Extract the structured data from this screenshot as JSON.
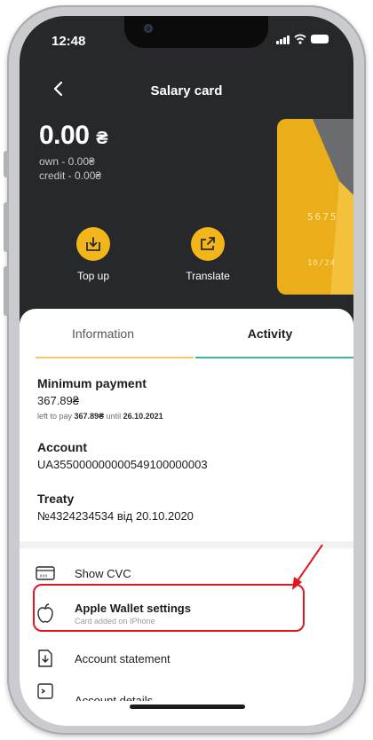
{
  "status_bar": {
    "time": "12:48"
  },
  "header": {
    "title": "Salary card"
  },
  "balance": {
    "amount": "0.00",
    "currency_symbol": "₴",
    "own": "own - 0.00₴",
    "credit": "credit - 0.00₴"
  },
  "card": {
    "number_fragment": "5675",
    "expiry": "10/24"
  },
  "actions": [
    {
      "label": "Top up",
      "icon": "download-icon"
    },
    {
      "label": "Translate",
      "icon": "share-out-icon"
    }
  ],
  "tabs": [
    {
      "label": "Information",
      "active": false
    },
    {
      "label": "Activity",
      "active": true
    }
  ],
  "minimum_payment": {
    "title": "Minimum payment",
    "value": "367.89₴",
    "note_prefix": "left to pay",
    "note_amount": "367.89₴",
    "note_until": "until",
    "note_date": "26.10.2021"
  },
  "account": {
    "title": "Account",
    "value": "UA355000000000549100000003"
  },
  "treaty": {
    "title": "Treaty",
    "value": "№4324234534 від 20.10.2020"
  },
  "menu": [
    {
      "label": "Show CVC",
      "icon": "cvc-card-icon"
    },
    {
      "label": "Apple Wallet settings",
      "sub": "Card added on IPhone",
      "icon": "apple-icon"
    },
    {
      "label": "Account statement",
      "icon": "statement-download-icon"
    },
    {
      "label": "Account details",
      "icon": "details-icon"
    }
  ],
  "colors": {
    "accent_yellow": "#f2b51a",
    "tab_active_line": "#3fb59a",
    "tab_inactive_line": "#f2c86e",
    "highlight_red": "#e0171f",
    "dark_bg": "#26282b"
  }
}
